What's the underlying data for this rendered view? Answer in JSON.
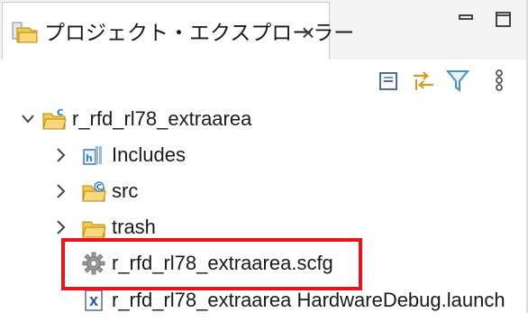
{
  "view": {
    "tab_title": "プロジェクト・エクスプローラー",
    "tab_close": "×",
    "tab_icon": "project-explorer-icon",
    "window_buttons": [
      "minimize-icon",
      "maximize-icon"
    ]
  },
  "toolbar": {
    "tools": [
      "collapse-all-icon",
      "link-with-editor-icon",
      "filter-icon",
      "view-menu-icon"
    ]
  },
  "tree": {
    "project": {
      "label": "r_rfd_rl78_extraarea",
      "expanded": true,
      "icon": "c-project-folder-icon"
    },
    "children": [
      {
        "label": "Includes",
        "icon": "includes-icon",
        "expandable": true
      },
      {
        "label": "src",
        "icon": "source-folder-icon",
        "expandable": true
      },
      {
        "label": "trash",
        "icon": "folder-icon",
        "expandable": true
      },
      {
        "label": "r_rfd_rl78_extraarea.scfg",
        "icon": "gear-icon",
        "expandable": false,
        "highlighted": true
      },
      {
        "label": "r_rfd_rl78_extraarea HardwareDebug.launch",
        "icon": "launch-config-icon",
        "expandable": false
      }
    ]
  },
  "colors": {
    "highlight_border": "#e8141b",
    "tab_bg": "#ffffff",
    "header_bg": "#f3f3f3"
  }
}
